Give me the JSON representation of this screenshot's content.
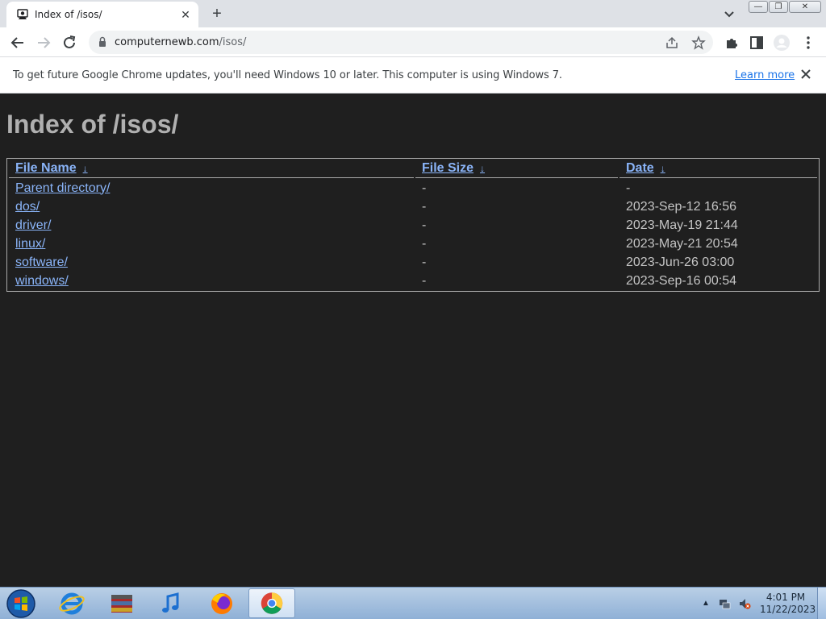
{
  "browser": {
    "tab_title": "Index of /isos/",
    "url_host": "computernewb.com",
    "url_path": "/isos/"
  },
  "infobar": {
    "message": "To get future Google Chrome updates, you'll need Windows 10 or later. This computer is using Windows 7.",
    "learn_more": "Learn more"
  },
  "page": {
    "heading": "Index of /isos/",
    "columns": {
      "name": "File Name",
      "size": "File Size",
      "date": "Date",
      "sort_arrow": "↓"
    },
    "rows": [
      {
        "name": "Parent directory/",
        "size": "-",
        "date": "-"
      },
      {
        "name": "dos/",
        "size": "-",
        "date": "2023-Sep-12 16:56"
      },
      {
        "name": "driver/",
        "size": "-",
        "date": "2023-May-19 21:44"
      },
      {
        "name": "linux/",
        "size": "-",
        "date": "2023-May-21 20:54"
      },
      {
        "name": "software/",
        "size": "-",
        "date": "2023-Jun-26 03:00"
      },
      {
        "name": "windows/",
        "size": "-",
        "date": "2023-Sep-16 00:54"
      }
    ]
  },
  "taskbar": {
    "time": "4:01 PM",
    "date": "11/22/2023",
    "apps": [
      "internet-explorer",
      "archive-manager",
      "itunes",
      "firefox",
      "chrome"
    ]
  }
}
